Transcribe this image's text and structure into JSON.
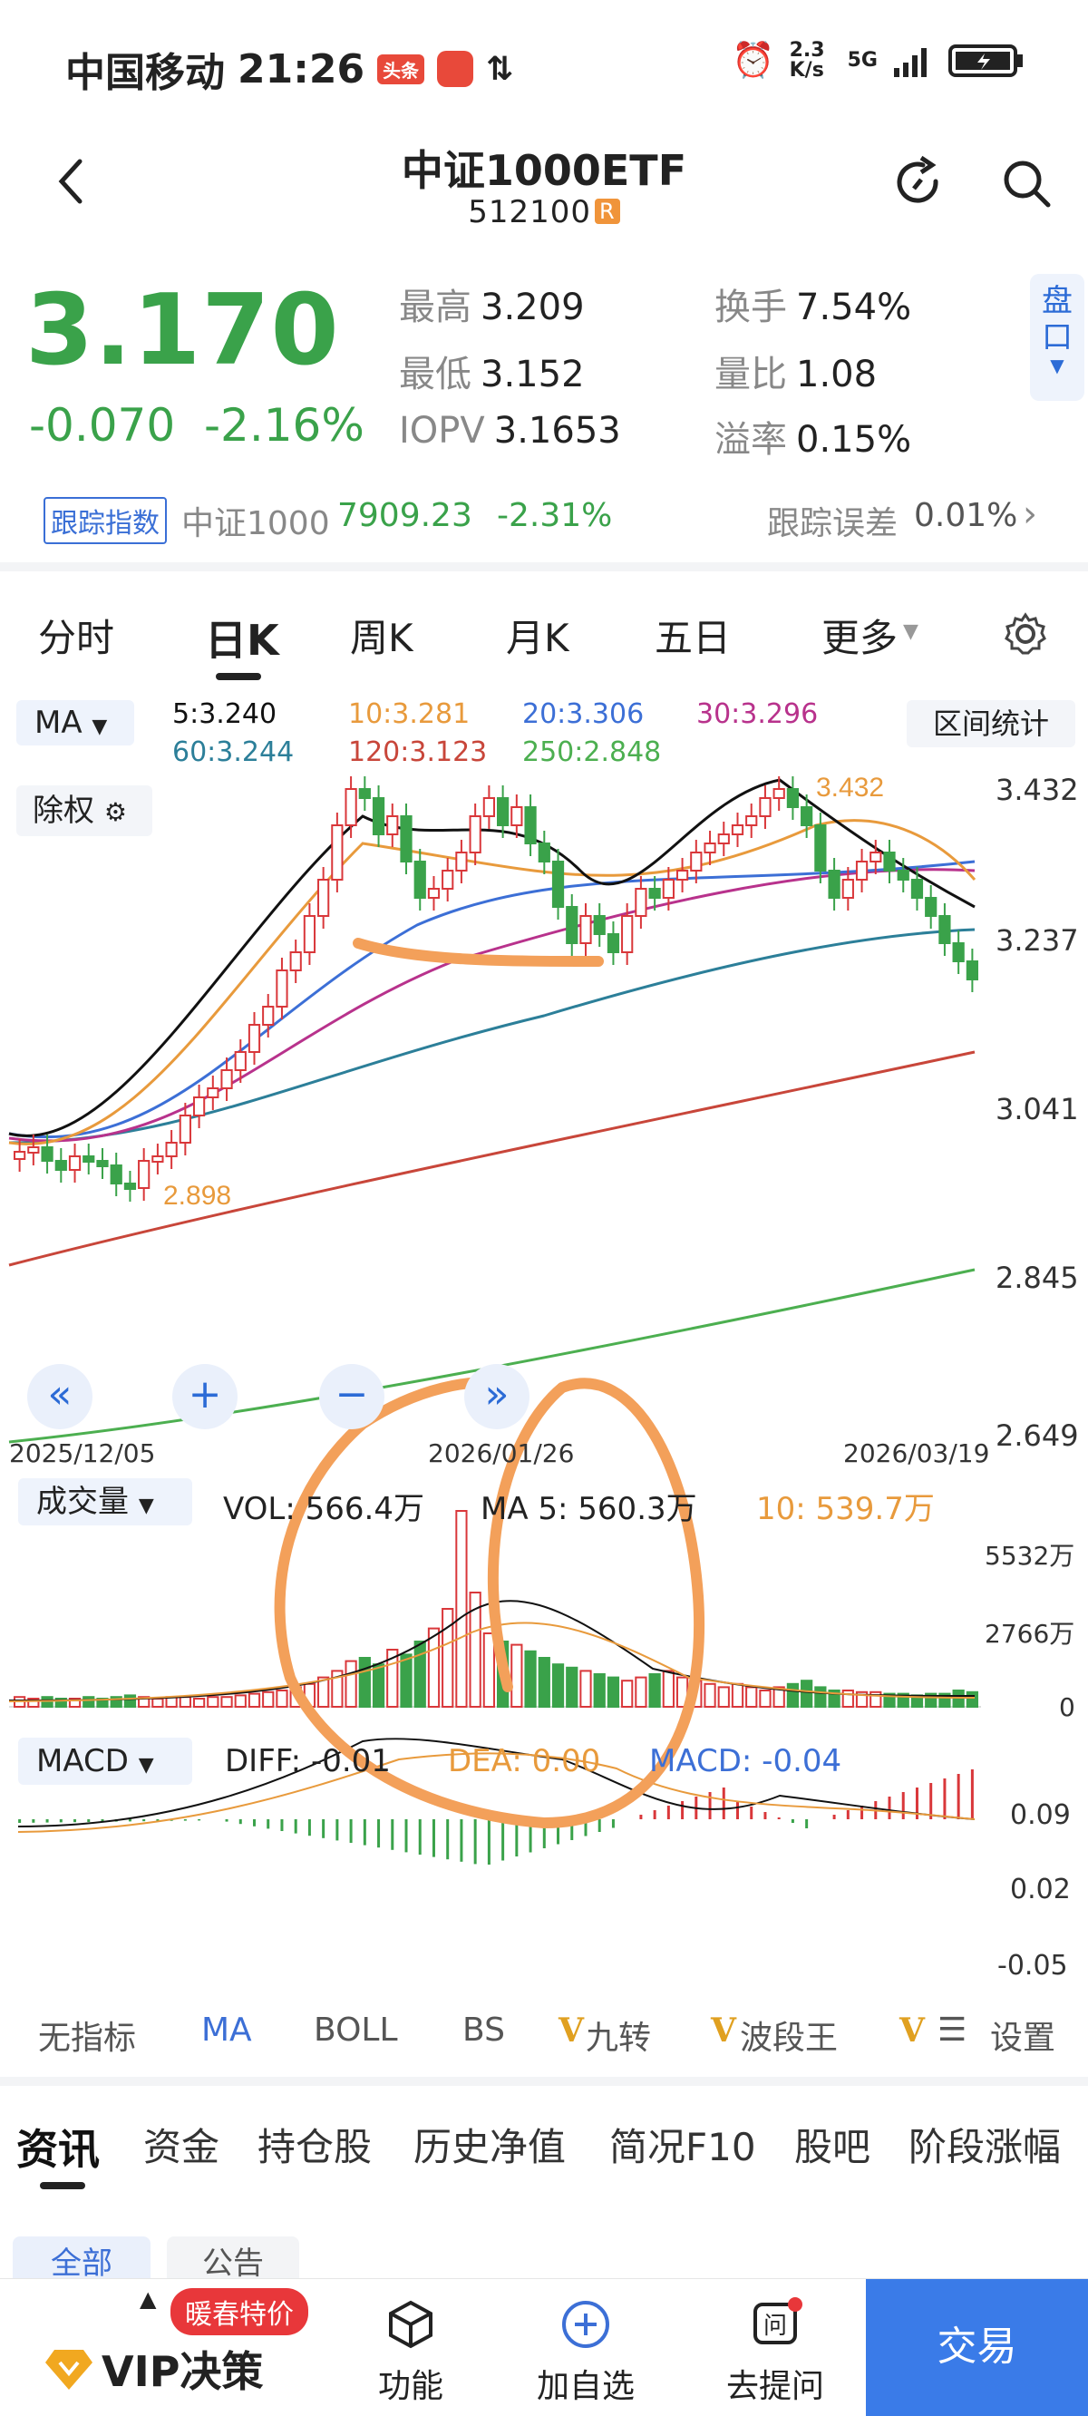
{
  "status_bar": {
    "carrier": "中国移动",
    "time": "21:26",
    "app_tag": "头条",
    "net_speed": "2.3 K/s",
    "net_type": "5G"
  },
  "header": {
    "title": "中证1000ETF",
    "code": "512100",
    "code_badge": "R"
  },
  "quote": {
    "price": "3.170",
    "change": "-0.070",
    "change_pct": "-2.16%",
    "high_label": "最高",
    "high": "3.209",
    "low_label": "最低",
    "low": "3.152",
    "iopv_label": "IOPV",
    "iopv": "3.1653",
    "turnover_label": "换手",
    "turnover": "7.54%",
    "volume_ratio_label": "量比",
    "volume_ratio": "1.08",
    "premium_label": "溢率",
    "premium": "0.15%",
    "pankou": "盘口"
  },
  "tracking": {
    "badge": "跟踪指数",
    "index_name": "中证1000",
    "index_value": "7909.23",
    "index_change": "-2.31%",
    "error_label": "跟踪误差",
    "error_value": "0.01%"
  },
  "period_tabs": [
    "分时",
    "日K",
    "周K",
    "月K",
    "五日",
    "更多"
  ],
  "chart": {
    "ma_selector": "MA",
    "ma5": "5:3.240",
    "ma10": "10:3.281",
    "ma20": "20:3.306",
    "ma30": "30:3.296",
    "ma60": "60:3.244",
    "ma120": "120:3.123",
    "ma250": "250:2.848",
    "range_stats": "区间统计",
    "adjust": "除权",
    "y_ticks": [
      "3.432",
      "3.237",
      "3.041",
      "2.845",
      "2.649"
    ],
    "high_mark": "3.432",
    "low_mark": "2.898",
    "dates": [
      "2025/12/05",
      "2026/01/26",
      "2026/03/19"
    ],
    "vol_selector": "成交量",
    "vol": "VOL: 566.4万",
    "vol_ma5": "MA 5: 560.3万",
    "vol_ma10": "10: 539.7万",
    "vol_ticks": [
      "5532万",
      "2766万",
      "0"
    ],
    "macd_selector": "MACD",
    "diff": "DIFF: -0.01",
    "dea": "DEA: 0.00",
    "macd": "MACD: -0.04",
    "macd_ticks": [
      "0.09",
      "0.02",
      "-0.05"
    ],
    "colors": {
      "up": "#d9373a",
      "down": "#3aa24a",
      "ma5": "#111111",
      "ma10": "#e89a3c",
      "ma20": "#3c6fd6",
      "ma30": "#b8328c",
      "ma60": "#2c7f99",
      "ma120": "#c8463a",
      "ma250": "#4caf50",
      "annotation": "#f3a05a"
    }
  },
  "indicator_tabs": [
    "无指标",
    "MA",
    "BOLL",
    "BS",
    "九转",
    "波段王",
    "设置"
  ],
  "news_tabs": [
    "资讯",
    "资金",
    "持仓股",
    "历史净值",
    "简况F10",
    "股吧",
    "阶段涨幅"
  ],
  "sub_tabs": [
    "全部",
    "公告"
  ],
  "bottom_bar": {
    "vip_promo": "暖春特价",
    "vip": "VIP决策",
    "function": "功能",
    "add": "加自选",
    "ask": "去提问",
    "trade": "交易"
  }
}
